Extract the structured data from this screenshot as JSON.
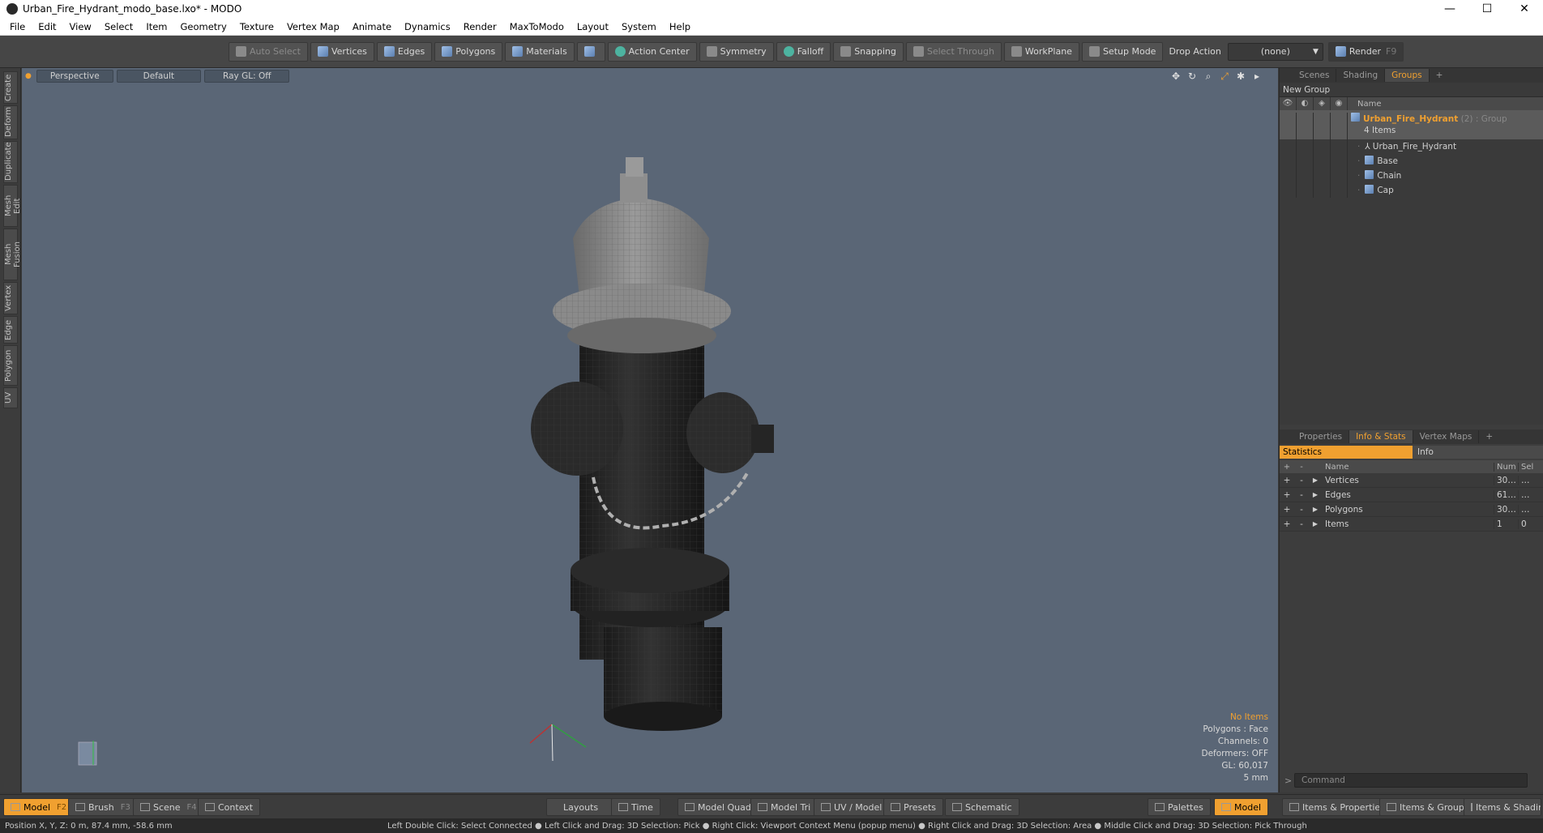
{
  "window": {
    "title": "Urban_Fire_Hydrant_modo_base.lxo* - MODO"
  },
  "menu": [
    "File",
    "Edit",
    "View",
    "Select",
    "Item",
    "Geometry",
    "Texture",
    "Vertex Map",
    "Animate",
    "Dynamics",
    "Render",
    "MaxToModo",
    "Layout",
    "System",
    "Help"
  ],
  "toolbar": {
    "auto_select": "Auto Select",
    "vertices": "Vertices",
    "edges": "Edges",
    "polygons": "Polygons",
    "materials": "Materials",
    "action_center": "Action Center",
    "symmetry": "Symmetry",
    "falloff": "Falloff",
    "snapping": "Snapping",
    "select_through": "Select Through",
    "workplane": "WorkPlane",
    "setup_mode": "Setup Mode",
    "drop_action": "Drop Action",
    "drop_value": "(none)",
    "render": "Render",
    "render_key": "F9"
  },
  "left_tabs": [
    "Create",
    "Deform",
    "Duplicate",
    "Mesh Edit",
    "Mesh Fusion",
    "Vertex",
    "Edge",
    "Polygon",
    "UV"
  ],
  "viewport": {
    "view": "Perspective",
    "shading": "Default",
    "raygl": "Ray GL: Off",
    "info": {
      "no_items": "No Items",
      "polygons": "Polygons : Face",
      "channels": "Channels: 0",
      "deformers": "Deformers: OFF",
      "gl": "GL: 60,017",
      "scale": "5 mm"
    }
  },
  "scene_panel": {
    "tabs": [
      "Scenes",
      "Shading",
      "Groups"
    ],
    "new_group": "New Group",
    "name_header": "Name",
    "group": {
      "name": "Urban_Fire_Hydrant",
      "suffix": "(2) : Group",
      "count": "4 Items"
    },
    "items": [
      "Urban_Fire_Hydrant",
      "Base",
      "Chain",
      "Cap"
    ]
  },
  "info_panel": {
    "tabs": [
      "Properties",
      "Info & Stats",
      "Vertex Maps"
    ],
    "statistics": "Statistics",
    "info": "Info",
    "headers": {
      "name": "Name",
      "num": "Num",
      "sel": "Sel"
    },
    "rows": [
      {
        "name": "Vertices",
        "num": "30…",
        "sel": "…"
      },
      {
        "name": "Edges",
        "num": "61…",
        "sel": "…"
      },
      {
        "name": "Polygons",
        "num": "30…",
        "sel": "…"
      },
      {
        "name": "Items",
        "num": "1",
        "sel": "0"
      }
    ],
    "command_placeholder": "Command"
  },
  "bottom": {
    "model": "Model",
    "model_key": "F2",
    "brush": "Brush",
    "brush_key": "F3",
    "scene": "Scene",
    "scene_key": "F4",
    "context": "Context",
    "layouts": "Layouts",
    "time": "Time",
    "model_quad": "Model Quad",
    "model_tri": "Model Tri",
    "uv_model": "UV / Model",
    "presets": "Presets",
    "schematic": "Schematic",
    "palettes": "Palettes",
    "model_right": "Model",
    "items_props": "Items & Properties",
    "items_groups": "Items & Groups",
    "items_shading": "Items & Shading"
  },
  "status": {
    "position": "Position X, Y, Z:  0 m, 87.4 mm, -58.6 mm",
    "hints": "Left Double Click: Select Connected ● Left Click and Drag: 3D Selection: Pick ● Right Click: Viewport Context Menu (popup menu) ● Right Click and Drag: 3D Selection: Area ● Middle Click and Drag: 3D Selection: Pick Through"
  },
  "colors": {
    "accent": "#f0a030",
    "viewport_bg": "#5a6676"
  }
}
